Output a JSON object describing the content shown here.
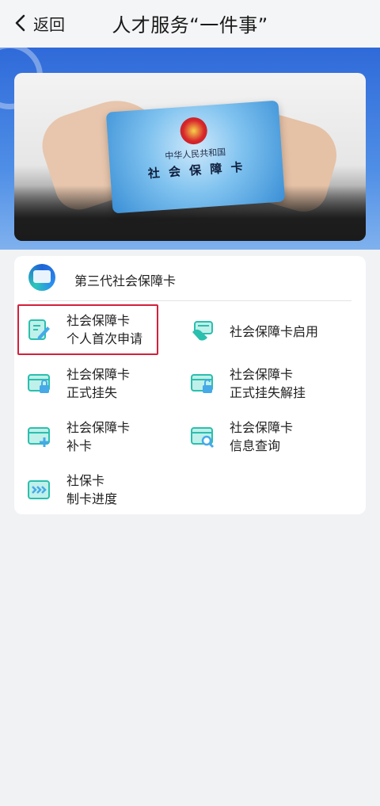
{
  "nav": {
    "back_label": "返回",
    "title": "人才服务“一件事”"
  },
  "banner": {
    "card_country": "中华人民共和国",
    "card_name": "社 会 保 障 卡"
  },
  "panel": {
    "title": "第三代社会保障卡",
    "items": [
      {
        "line1": "社会保障卡",
        "line2": "个人首次申请",
        "icon": "edit-document-icon"
      },
      {
        "line1": "社会保障卡启用",
        "line2": "",
        "icon": "card-activate-icon"
      },
      {
        "line1": "社会保障卡",
        "line2": "正式挂失",
        "icon": "card-lock-icon"
      },
      {
        "line1": "社会保障卡",
        "line2": "正式挂失解挂",
        "icon": "card-unlock-icon"
      },
      {
        "line1": "社会保障卡",
        "line2": "补卡",
        "icon": "card-add-icon"
      },
      {
        "line1": "社会保障卡",
        "line2": "信息查询",
        "icon": "card-search-icon"
      },
      {
        "line1": "社保卡",
        "line2": "制卡进度",
        "icon": "progress-icon"
      }
    ]
  },
  "colors": {
    "icon_teal": "#2bbfae",
    "icon_blue": "#46a9e8",
    "highlight": "#d3203a",
    "hero_blue": "#2f6ad9"
  }
}
